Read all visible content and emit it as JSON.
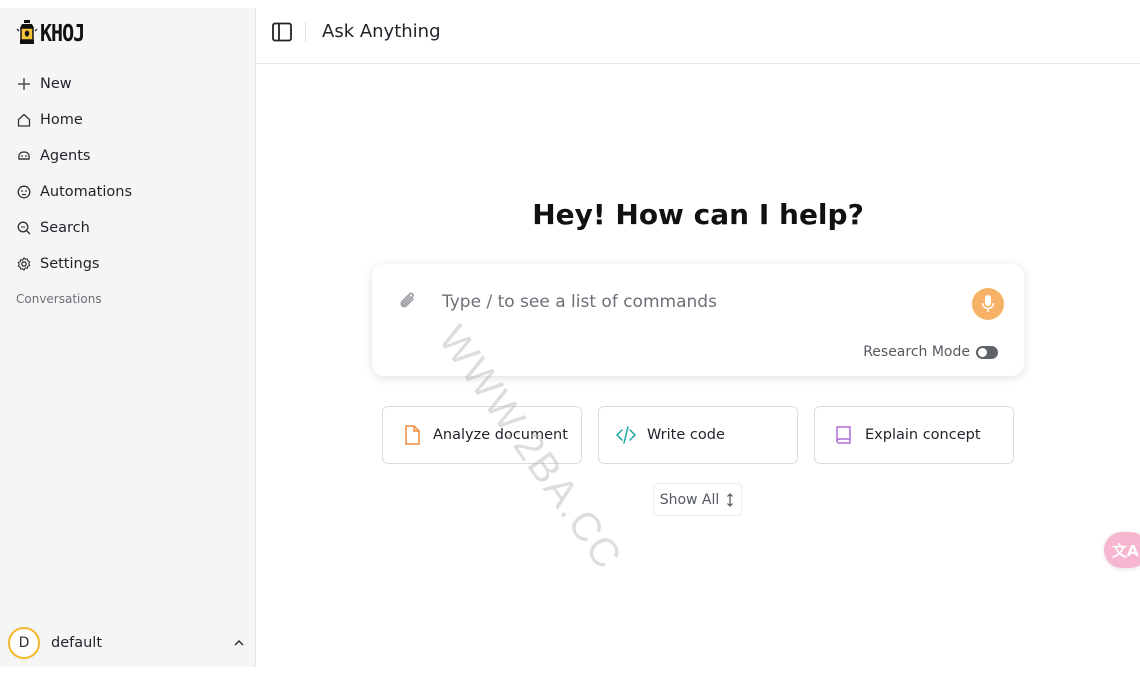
{
  "sidebar": {
    "logo_text": "KHOJ",
    "nav": [
      {
        "label": "New",
        "icon": "plus-icon"
      },
      {
        "label": "Home",
        "icon": "home-icon"
      },
      {
        "label": "Agents",
        "icon": "agents-icon"
      },
      {
        "label": "Automations",
        "icon": "automations-icon"
      },
      {
        "label": "Search",
        "icon": "search-icon"
      },
      {
        "label": "Settings",
        "icon": "gear-icon"
      }
    ],
    "section_label": "Conversations",
    "user": {
      "initial": "D",
      "name": "default"
    }
  },
  "header": {
    "title": "Ask Anything"
  },
  "main": {
    "greeting": "Hey! How can I help?",
    "input_placeholder": "Type / to see a list of commands",
    "research_mode_label": "Research Mode",
    "research_mode_on": false,
    "suggestions": [
      {
        "label": "Analyze document",
        "icon": "document-icon",
        "color": "#f08a3c"
      },
      {
        "label": "Write code",
        "icon": "code-icon",
        "color": "#1aa8a0"
      },
      {
        "label": "Explain concept",
        "icon": "book-icon",
        "color": "#b06bd6"
      }
    ],
    "show_all_label": "Show All"
  },
  "overlay": {
    "watermark": "WWW.2BA.CC",
    "translate_label": "文A"
  },
  "colors": {
    "mic": "#f7b267",
    "avatar_ring": "#f2b72c",
    "sidebar_bg": "#f5f5f5"
  }
}
